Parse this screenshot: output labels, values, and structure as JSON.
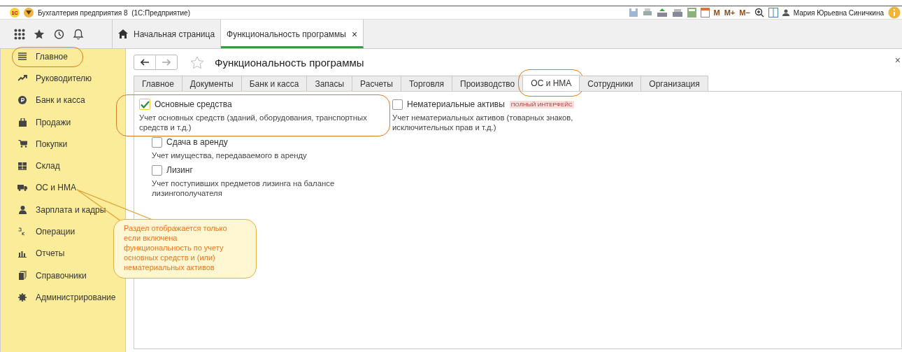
{
  "window": {
    "logo": "1С",
    "title": "Бухгалтерия предприятия 8  (1С:Предприятие)",
    "memory_buttons": [
      "M",
      "M+",
      "M−"
    ],
    "user": "Мария Юрьевна Синичкина"
  },
  "nav_tabs": [
    {
      "label": "Начальная страница",
      "selected": false,
      "kind": "home"
    },
    {
      "label": "Функциональность программы",
      "selected": true,
      "kind": "page",
      "close": "×"
    }
  ],
  "sidebar": {
    "items": [
      {
        "label": "Главное",
        "annotated": true
      },
      {
        "label": "Руководителю",
        "annotated": false
      },
      {
        "label": "Банк и касса",
        "annotated": false
      },
      {
        "label": "Продажи",
        "annotated": false
      },
      {
        "label": "Покупки",
        "annotated": false
      },
      {
        "label": "Склад",
        "annotated": false
      },
      {
        "label": "ОС и НМА",
        "annotated": false
      },
      {
        "label": "Зарплата и кадры",
        "annotated": false
      },
      {
        "label": "Операции",
        "annotated": false
      },
      {
        "label": "Отчеты",
        "annotated": false
      },
      {
        "label": "Справочники",
        "annotated": false
      },
      {
        "label": "Администрирование",
        "annotated": false
      }
    ]
  },
  "form": {
    "title": "Функциональность программы",
    "close": "×",
    "tabs": [
      {
        "label": "Главное",
        "selected": false,
        "annotated": false
      },
      {
        "label": "Документы",
        "selected": false,
        "annotated": false
      },
      {
        "label": "Банк и касса",
        "selected": false,
        "annotated": false
      },
      {
        "label": "Запасы",
        "selected": false,
        "annotated": false
      },
      {
        "label": "Расчеты",
        "selected": false,
        "annotated": false
      },
      {
        "label": "Торговля",
        "selected": false,
        "annotated": false
      },
      {
        "label": "Производство",
        "selected": false,
        "annotated": false
      },
      {
        "label": "ОС и НМА",
        "selected": true,
        "annotated": true
      },
      {
        "label": "Сотрудники",
        "selected": false,
        "annotated": false
      },
      {
        "label": "Организация",
        "selected": false,
        "annotated": false
      }
    ],
    "columns": [
      [
        {
          "label": "Основные средства",
          "checked": true,
          "annotated": true,
          "description": "Учет основных средств (зданий, оборудования, транспортных средств и т.д.)",
          "children": [
            {
              "label": "Сдача в аренду",
              "checked": false,
              "description": "Учет имущества, передаваемого в аренду"
            },
            {
              "label": "Лизинг",
              "checked": false,
              "description": "Учет поступивших предметов лизинга на балансе лизингополучателя"
            }
          ]
        }
      ],
      [
        {
          "label": "Нематериальные активы",
          "checked": false,
          "annotated": false,
          "badge": "ПОЛНЫЙ ИНТЕРФЕЙС",
          "description": "Учет нематериальных активов (товарных знаков, исключительных прав и т.д.)"
        }
      ]
    ]
  },
  "callout": {
    "text": "Раздел отображается только если включена функциональность по учету основных средств и (или) нематериальных активов"
  }
}
